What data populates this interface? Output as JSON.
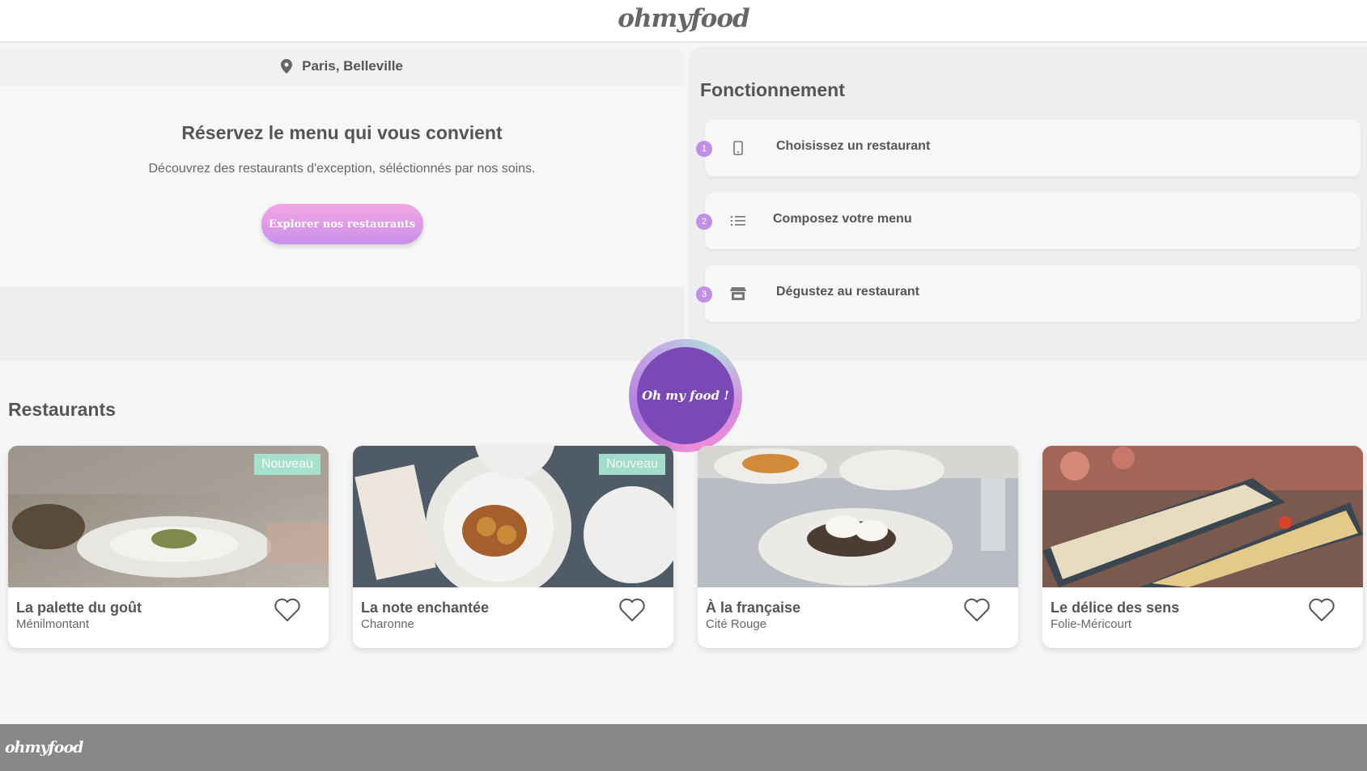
{
  "header": {
    "logo": "ohmyfood"
  },
  "hero": {
    "location": "Paris, Belleville",
    "location_icon": "map-pin-icon",
    "title": "Réservez le menu qui vous convient",
    "subtitle": "Découvrez des restaurants d'exception, séléctionnés par nos soins.",
    "cta": "Explorer nos restaurants"
  },
  "steps": {
    "title": "Fonctionnement",
    "items": [
      {
        "num": "1",
        "icon": "smartphone-icon",
        "label": "Choisissez un restaurant"
      },
      {
        "num": "2",
        "icon": "list-icon",
        "label": "Composez votre menu"
      },
      {
        "num": "3",
        "icon": "store-icon",
        "label": "Dégustez au restaurant"
      }
    ]
  },
  "badge": {
    "text": "Oh my food !"
  },
  "restaurants": {
    "title": "Restaurants",
    "new_label": "Nouveau",
    "items": [
      {
        "name": "La palette du goût",
        "location": "Ménilmontant",
        "is_new": true
      },
      {
        "name": "La note enchantée",
        "location": "Charonne",
        "is_new": true
      },
      {
        "name": "À la française",
        "location": "Cité Rouge",
        "is_new": false
      },
      {
        "name": "Le délice des sens",
        "location": "Folie-Méricourt",
        "is_new": false
      }
    ]
  },
  "footer": {
    "logo": "ohmyfood"
  },
  "colors": {
    "accent_purple": "#7a49b5",
    "step_number": "#c18fe6",
    "new_tag": "#a8e4d0",
    "cta_gradient_top": "#f3a6e1",
    "cta_gradient_bottom": "#c890ea",
    "footer": "#878787"
  }
}
